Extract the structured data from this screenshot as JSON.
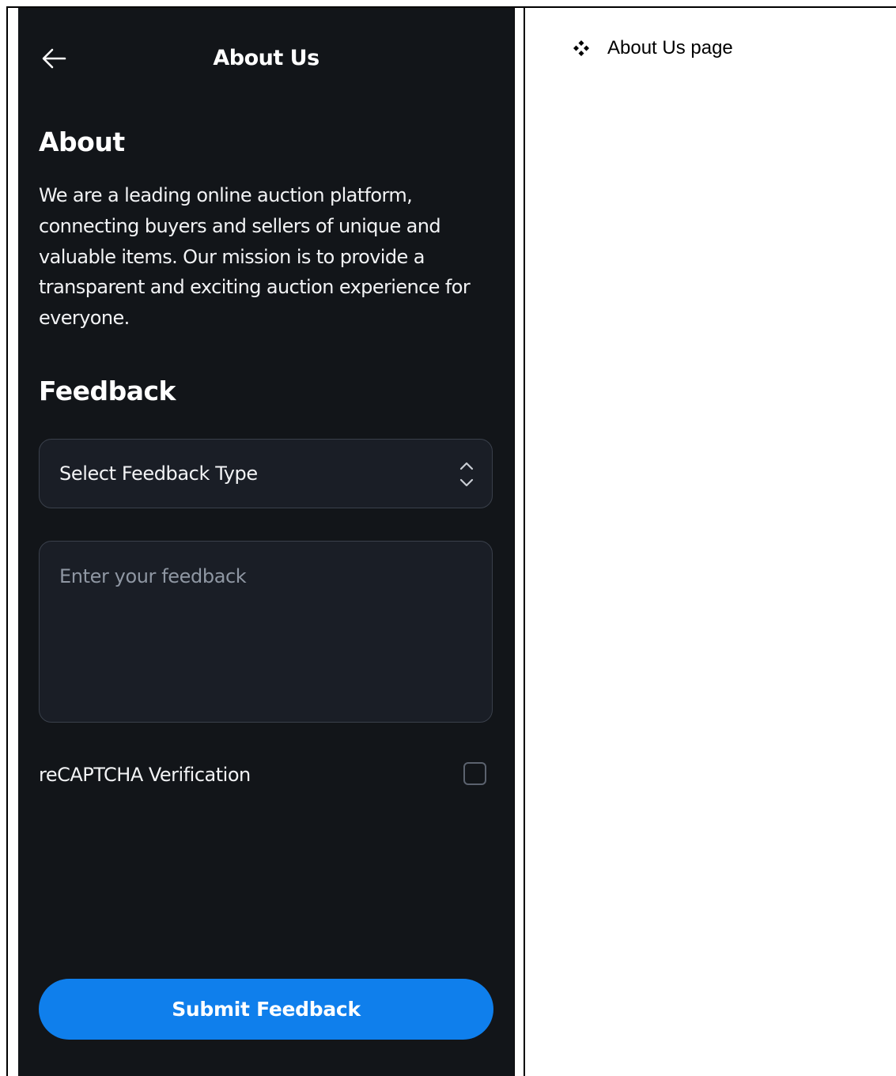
{
  "phone": {
    "header": {
      "back_icon": "arrow-left-icon",
      "title": "About Us"
    },
    "about": {
      "heading": "About",
      "body": "We are a leading online auction platform, connecting buyers and sellers of unique and valuable items. Our mission is to provide a transparent and exciting auction experience for everyone."
    },
    "feedback": {
      "heading": "Feedback",
      "type_select": {
        "selected_value": "Select Feedback Type",
        "icon": "chevron-up-down-icon"
      },
      "message": {
        "value": "",
        "placeholder": "Enter your feedback"
      },
      "recaptcha": {
        "label": "reCAPTCHA Verification",
        "checked": false
      },
      "submit_label": "Submit Feedback"
    },
    "colors": {
      "background": "#121519",
      "field_background": "#1a1e26",
      "field_border": "#3a404b",
      "accent": "#0f7fec"
    }
  },
  "document": {
    "bullet_icon": "four-diamond-bullet-icon",
    "bullet_text": "About Us page"
  }
}
